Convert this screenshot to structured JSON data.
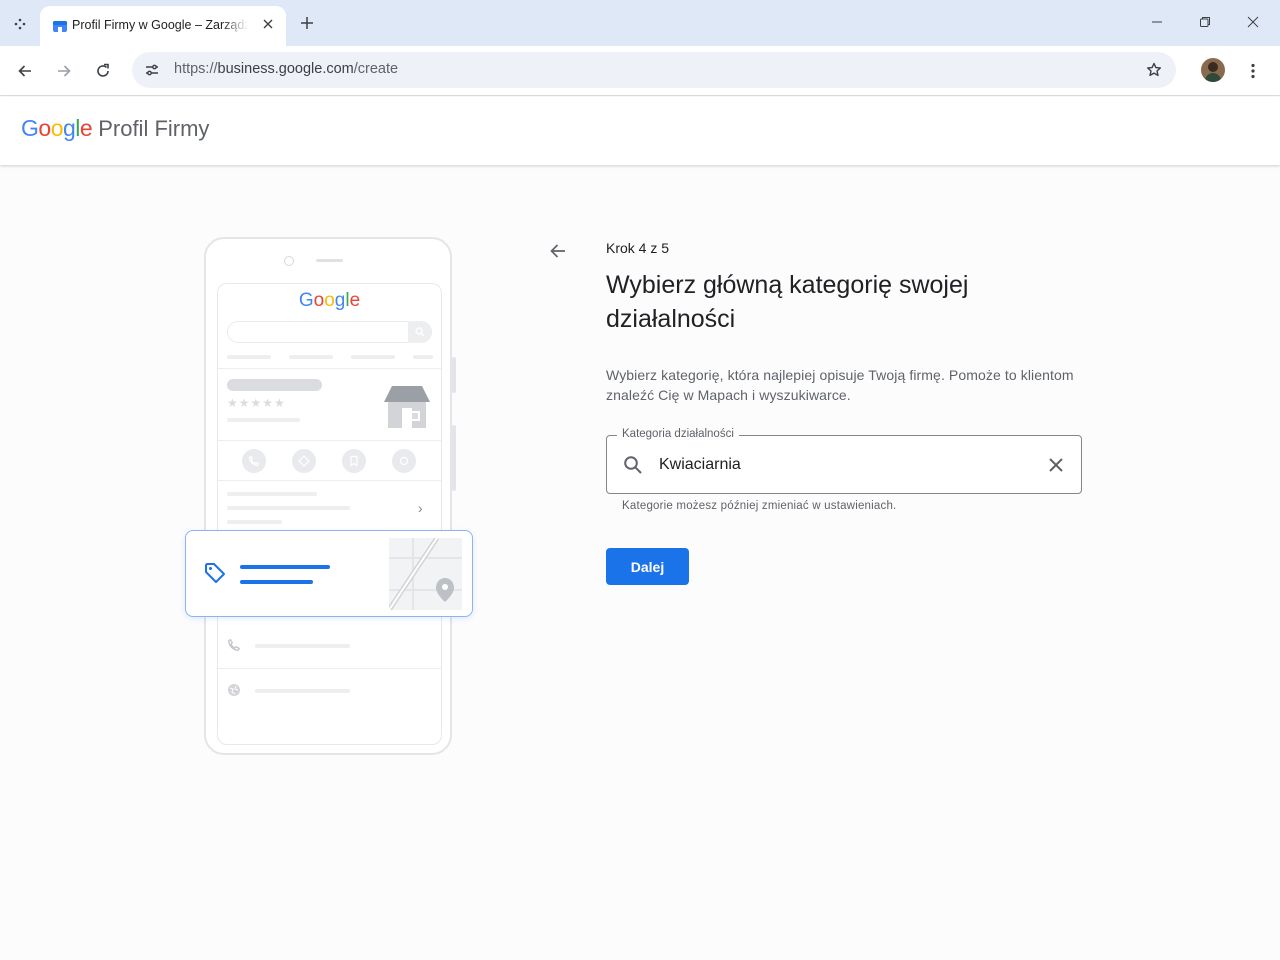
{
  "browser": {
    "tab_title": "Profil Firmy w Google – Zarządzaj",
    "url_scheme": "https://",
    "url_host": "business.google.com",
    "url_path": "/create"
  },
  "header": {
    "logo_google": "Google",
    "product_name": "Profil Firmy"
  },
  "illustration": {
    "search_logo": "Google"
  },
  "form": {
    "step": "Krok 4 z 5",
    "title": "Wybierz główną kategorię swojej działalności",
    "description": "Wybierz kategorię, która najlepiej opisuje Twoją firmę. Pomoże to klientom znaleźć Cię w Mapach i wyszukiwarce.",
    "field_label": "Kategoria działalności",
    "field_value": "Kwiaciarnia",
    "helper": "Kategorie możesz później zmieniać w ustawieniach.",
    "next_label": "Dalej"
  },
  "colors": {
    "accent": "#1a73e8",
    "google_blue": "#4285f4",
    "google_red": "#ea4335",
    "google_yellow": "#fbbc05",
    "google_green": "#34a853"
  },
  "icons": [
    "tab-search-icon",
    "favicon-icon",
    "close-icon",
    "plus-icon",
    "minimize-icon",
    "restore-icon",
    "back-icon",
    "forward-icon",
    "reload-icon",
    "site-info-icon",
    "star-icon",
    "more-icon",
    "arrow-back-icon",
    "search-icon",
    "clear-icon",
    "tag-icon"
  ]
}
